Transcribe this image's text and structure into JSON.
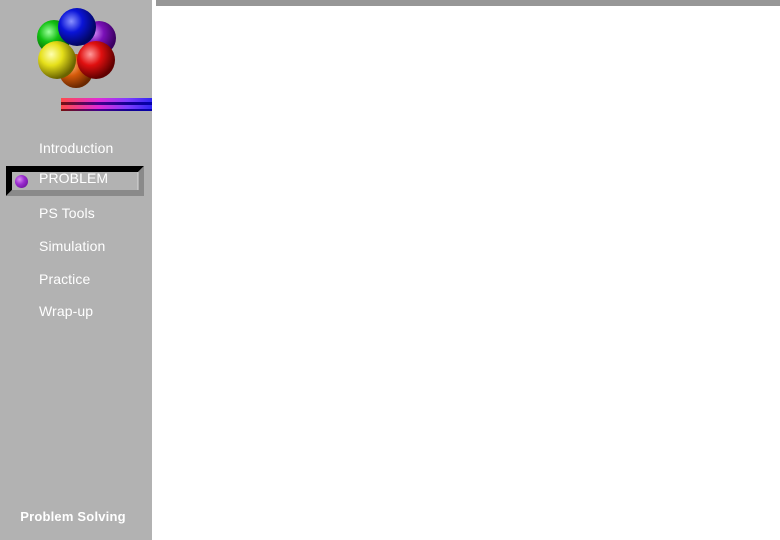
{
  "sidebar": {
    "logo": {
      "icon": "molecule-spheres-logo",
      "sphere_colors": {
        "green": "#10c010",
        "blue": "#0a14d8",
        "purple": "#7a10b8",
        "yellow": "#e6e01a",
        "red": "#e01010",
        "orange": "#d45a0a"
      }
    },
    "nav_items": [
      {
        "label": "Introduction",
        "active": false
      },
      {
        "label": "PROBLEM",
        "active": true
      },
      {
        "label": "PS Tools",
        "active": false
      },
      {
        "label": "Simulation",
        "active": false
      },
      {
        "label": "Practice",
        "active": false
      },
      {
        "label": "Wrap-up",
        "active": false
      }
    ],
    "active_bullet_icon": "purple-sphere-bullet",
    "footer": "Problem Solving"
  },
  "colors": {
    "sidebar_bg": "#b2b2b2",
    "top_rule": "#979797",
    "content_bg": "#ffffff",
    "nav_text": "#ffffff",
    "active_bullet": "#9b2ed0"
  }
}
